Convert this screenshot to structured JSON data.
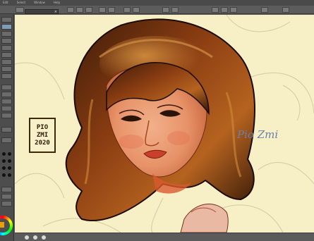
{
  "menu": {
    "items": [
      "Edit",
      "Select",
      "Window",
      "Help"
    ]
  },
  "artwork": {
    "signature": "Pio Zmi",
    "stamp": {
      "line1": "PIO",
      "line2": "ZMI",
      "line3": "2020"
    }
  },
  "colors": {
    "canvas": "#f7efc6",
    "ui_panel": "#4d4d4d",
    "accent": "#e8a100",
    "signature": "#6a7fb0"
  },
  "icons": [
    "color-wheel-icon",
    "close-icon"
  ]
}
